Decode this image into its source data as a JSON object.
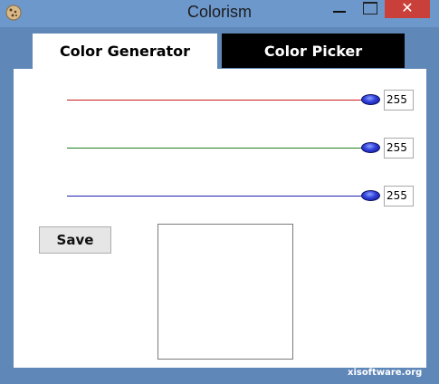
{
  "window": {
    "title": "Colorism",
    "close_label": "✕"
  },
  "tabs": [
    {
      "label": "Color Generator",
      "active": true
    },
    {
      "label": "Color Picker",
      "active": false
    }
  ],
  "sliders": [
    {
      "channel": "red",
      "color": "#c81e1e",
      "value": "255"
    },
    {
      "channel": "green",
      "color": "#1e7f1e",
      "value": "255"
    },
    {
      "channel": "blue",
      "color": "#2020b0",
      "value": "255"
    }
  ],
  "save_label": "Save",
  "preview_color": "#ffffff",
  "footer": {
    "watermark": "xisoftware.org"
  }
}
